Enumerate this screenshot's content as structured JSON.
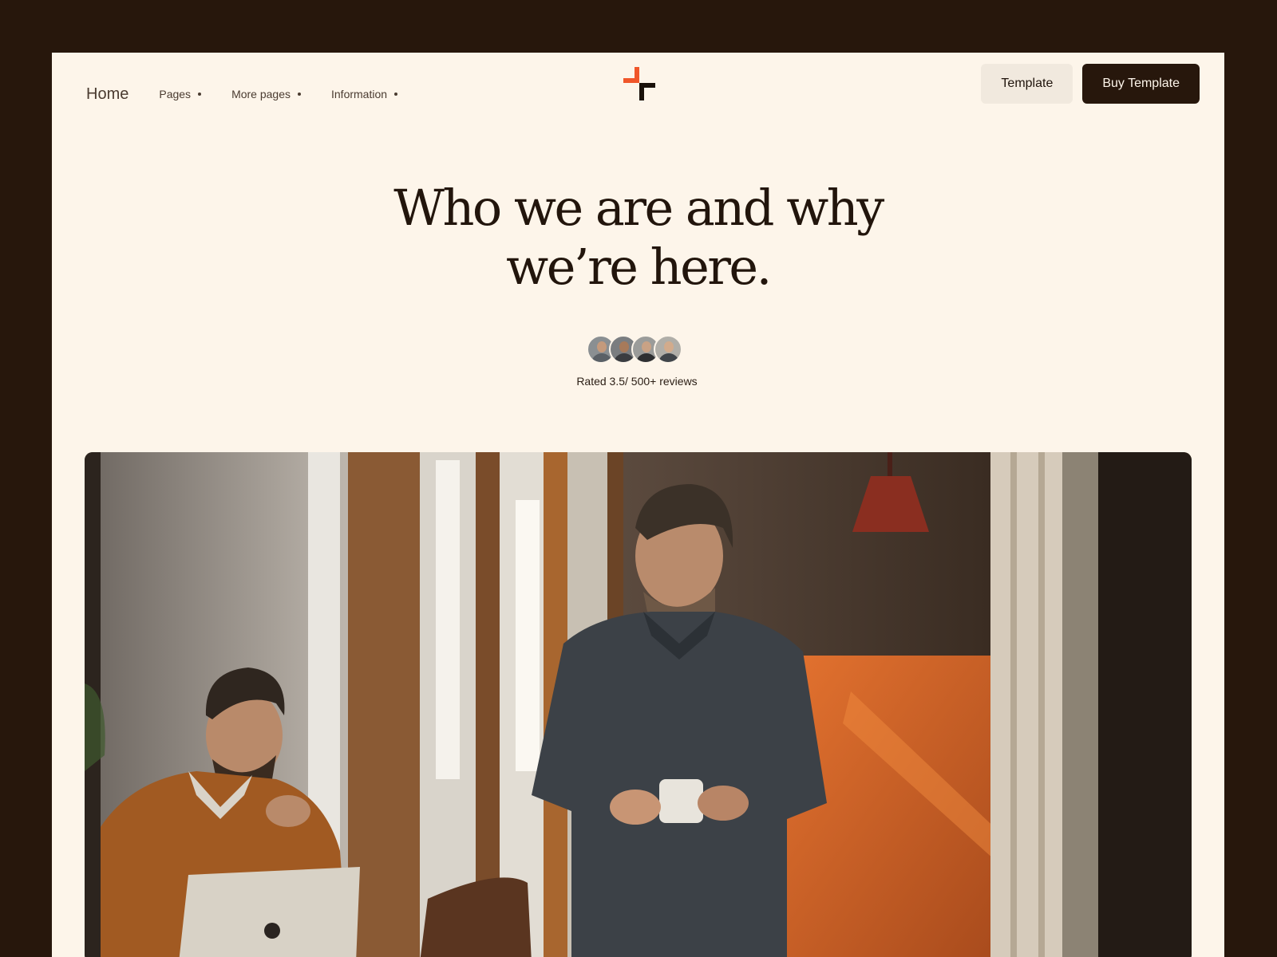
{
  "nav": {
    "home": "Home",
    "items": [
      {
        "label": "Pages"
      },
      {
        "label": "More pages"
      },
      {
        "label": "Information"
      }
    ]
  },
  "logo": {
    "icon": "brand-logo-icon",
    "accent": "#f0562a",
    "dark": "#1a110a"
  },
  "buttons": {
    "template": "Template",
    "buy": "Buy Template"
  },
  "hero": {
    "line1": "Who we are and why",
    "line2": "we’re here."
  },
  "reviews": {
    "rating_text": "Rated 3.5/ 500+ reviews",
    "avatar_count": 4
  },
  "photo": {
    "icon": "team-office-photo"
  },
  "colors": {
    "page_bg": "#27170c",
    "frame_bg": "#fdf5ea",
    "text_dark": "#22150c",
    "button_dark": "#27170c",
    "button_light": "#f1e9de"
  }
}
